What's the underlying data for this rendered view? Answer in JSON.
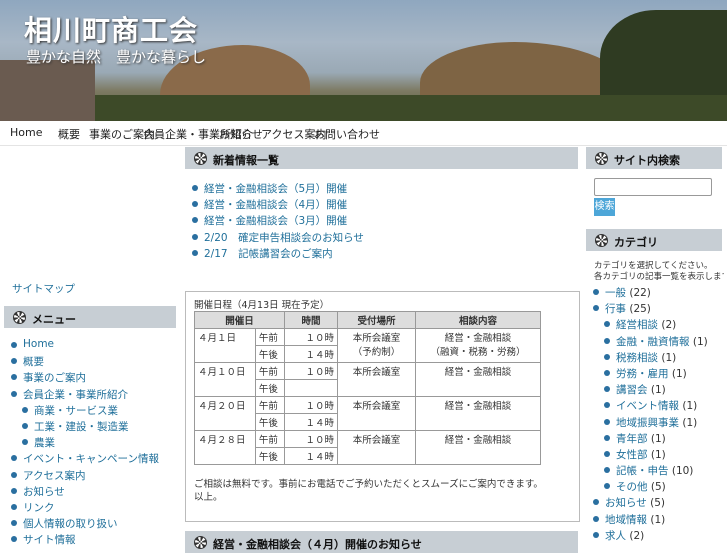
{
  "header": {
    "title": "相川町商工会",
    "subtitle": "豊かな自然　豊かな暮らし"
  },
  "nav": {
    "items": [
      "Home",
      "概要",
      "事業のご案内",
      "会員企業・事業所紹介",
      "お知らせ",
      "アクセス案内",
      "お問い合わせ"
    ]
  },
  "left": {
    "link": "サイトマップ",
    "menu_title": "メニュー",
    "menu": [
      {
        "label": "Home",
        "sub": false
      },
      {
        "label": "概要",
        "sub": false
      },
      {
        "label": "事業のご案内",
        "sub": false
      },
      {
        "label": "会員企業・事業所紹介",
        "sub": false
      },
      {
        "label": "商業・サービス業",
        "sub": true
      },
      {
        "label": "工業・建設・製造業",
        "sub": true
      },
      {
        "label": "農業",
        "sub": true
      },
      {
        "label": "イベント・キャンペーン情報",
        "sub": false
      },
      {
        "label": "アクセス案内",
        "sub": false
      },
      {
        "label": "お知らせ",
        "sub": false
      },
      {
        "label": "リンク",
        "sub": false
      },
      {
        "label": "個人情報の取り扱い",
        "sub": false
      },
      {
        "label": "サイト情報",
        "sub": false
      }
    ]
  },
  "main": {
    "news_title": "新着情報一覧",
    "news": [
      "経営・金融相談会（5月）開催",
      "経営・金融相談会（4月）開催",
      "経営・金融相談会（3月）開催",
      "2/20　確定申告相談会のお知らせ",
      "2/17　記帳講習会のご案内"
    ],
    "table_caption": "開催日程（4月13日 現在予定）",
    "table_headers": [
      "開催日",
      "時間",
      "受付場所",
      "相談内容"
    ],
    "table_rows": [
      {
        "date": "４月１日",
        "a": [
          "午前",
          "午後"
        ],
        "times": [
          "１０時",
          "１４時"
        ],
        "place": "本所会議室\n（予約制）",
        "topic": "経営・金融相談\n（融資・税務・労務）"
      },
      {
        "date": "４月１０日",
        "a": [
          "午前",
          "午後"
        ],
        "times": [
          "１０時",
          ""
        ],
        "place": "本所会議室",
        "topic": "経営・金融相談"
      },
      {
        "date": "４月２０日",
        "a": [
          "午前",
          "午後"
        ],
        "times": [
          "１０時",
          "１４時"
        ],
        "place": "本所会議室",
        "topic": "経営・金融相談"
      },
      {
        "date": "４月２８日",
        "a": [
          "午前",
          "午後"
        ],
        "times": [
          "１０時",
          "１４時"
        ],
        "place": "本所会議室",
        "topic": "経営・金融相談"
      }
    ],
    "table_note": "ご相談は無料です。事前にお電話でご予約いただくとスムーズにご案内できます。",
    "table_note2": "以上。",
    "next_title": "経営・金融相談会（４月）開催のお知らせ"
  },
  "right": {
    "search_title": "サイト内検索",
    "search_button": "検索",
    "search_placeholder": "",
    "cat_title": "カテゴリ",
    "cat_intro": "カテゴリを選択してください。",
    "cat_intro2": "各カテゴリの記事一覧を表示します。掲載中の記事数",
    "categories": [
      {
        "label": "一般",
        "count": "(22)",
        "sub": false
      },
      {
        "label": "行事",
        "count": "(25)",
        "sub": false
      },
      {
        "label": "経営相談",
        "count": "(2)",
        "sub": true
      },
      {
        "label": "金融・融資情報",
        "count": "(1)",
        "sub": true
      },
      {
        "label": "税務相談",
        "count": "(1)",
        "sub": true
      },
      {
        "label": "労務・雇用",
        "count": "(1)",
        "sub": true
      },
      {
        "label": "講習会",
        "count": "(1)",
        "sub": true
      },
      {
        "label": "イベント情報",
        "count": "(1)",
        "sub": true
      },
      {
        "label": "地域振興事業",
        "count": "(1)",
        "sub": true
      },
      {
        "label": "青年部",
        "count": "(1)",
        "sub": true
      },
      {
        "label": "女性部",
        "count": "(1)",
        "sub": true
      },
      {
        "label": "記帳・申告",
        "count": "(10)",
        "sub": true
      },
      {
        "label": "その他",
        "count": "(5)",
        "sub": true
      },
      {
        "label": "お知らせ",
        "count": "(5)",
        "sub": false
      },
      {
        "label": "地域情報",
        "count": "(1)",
        "sub": false
      },
      {
        "label": "求人",
        "count": "(2)",
        "sub": false
      }
    ]
  }
}
